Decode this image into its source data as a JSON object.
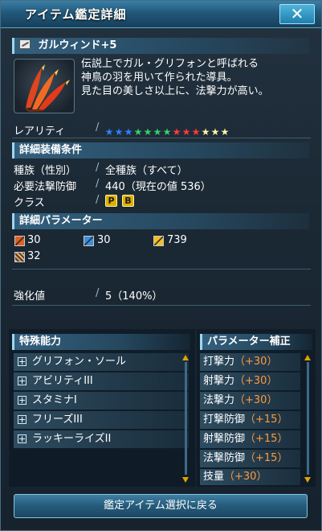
{
  "window": {
    "title": "アイテム鑑定詳細"
  },
  "item": {
    "name": "ガルウィンド+5",
    "description": [
      "伝説上でガル・グリフォンと呼ばれる",
      "神鳥の羽を用いて作られた導具。",
      "見た目の美しさ以上に、法撃力が高い。"
    ],
    "rarity_label": "レアリティ",
    "rarity_stars": 13,
    "star_colors": [
      "#2f7fff",
      "#2f7fff",
      "#2f7fff",
      "#35d06a",
      "#35d06a",
      "#35d06a",
      "#35d06a",
      "#ff3b3b",
      "#ff3b3b",
      "#ff3b3b",
      "#fff2a8",
      "#fff2a8",
      "#fff2a8"
    ]
  },
  "requirements": {
    "header": "詳細装備条件",
    "race_label": "種族（性別）",
    "race_value": "全種族（すべて）",
    "req_label": "必要法撃防御",
    "req_value": "440（現在の値 536）",
    "class_label": "クラス",
    "class_badges": [
      "P",
      "B"
    ]
  },
  "parameters": {
    "header": "詳細パラメーター",
    "stats": [
      {
        "icon": "melee-attack-icon",
        "value": "30"
      },
      {
        "icon": "ranged-attack-icon",
        "value": "30"
      },
      {
        "icon": "technique-attack-icon",
        "value": "739"
      },
      {
        "icon": "dexterity-icon",
        "value": "32"
      }
    ]
  },
  "enhance": {
    "label": "強化値",
    "value": "5（140%）"
  },
  "special_abilities": {
    "header": "特殊能力",
    "items": [
      "グリフォン・ソール",
      "アビリティIII",
      "スタミナI",
      "フリーズIII",
      "ラッキーライズII"
    ]
  },
  "param_bonus": {
    "header": "パラメーター補正",
    "items": [
      {
        "name": "打撃力",
        "value": "（+30）"
      },
      {
        "name": "射撃力",
        "value": "（+30）"
      },
      {
        "name": "法撃力",
        "value": "（+30）"
      },
      {
        "name": "打撃防御",
        "value": "（+15）"
      },
      {
        "name": "射撃防御",
        "value": "（+15）"
      },
      {
        "name": "法撃防御",
        "value": "（+15）"
      },
      {
        "name": "技量",
        "value": "（+30）"
      }
    ]
  },
  "footer": {
    "button_label": "鑑定アイテム選択に戻る"
  },
  "colors": {
    "accent": "#3a7fa6",
    "bonus": "#ff9a3c"
  }
}
